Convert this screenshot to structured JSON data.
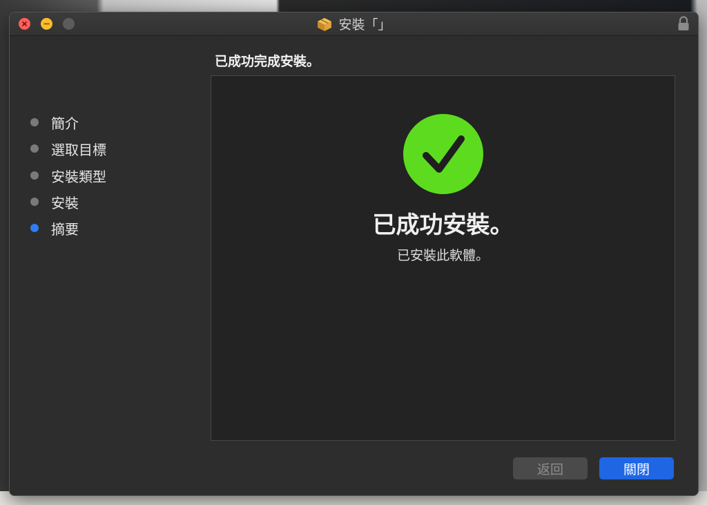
{
  "window": {
    "title": "安裝「」"
  },
  "sidebar": {
    "steps": [
      {
        "label": "簡介",
        "active": false
      },
      {
        "label": "選取目標",
        "active": false
      },
      {
        "label": "安裝類型",
        "active": false
      },
      {
        "label": "安裝",
        "active": false
      },
      {
        "label": "摘要",
        "active": true
      }
    ]
  },
  "main": {
    "heading": "已成功完成安裝。",
    "success_title": "已成功安裝。",
    "success_subtitle": "已安裝此軟體。"
  },
  "buttons": {
    "back_label": "返回",
    "close_label": "關閉"
  },
  "colors": {
    "accent": "#1f66e5",
    "active_step": "#2f7cf6",
    "success": "#5ddc1f"
  },
  "icons": {
    "title": "package-icon",
    "lock": "lock-icon",
    "success": "checkmark-circle-icon"
  }
}
